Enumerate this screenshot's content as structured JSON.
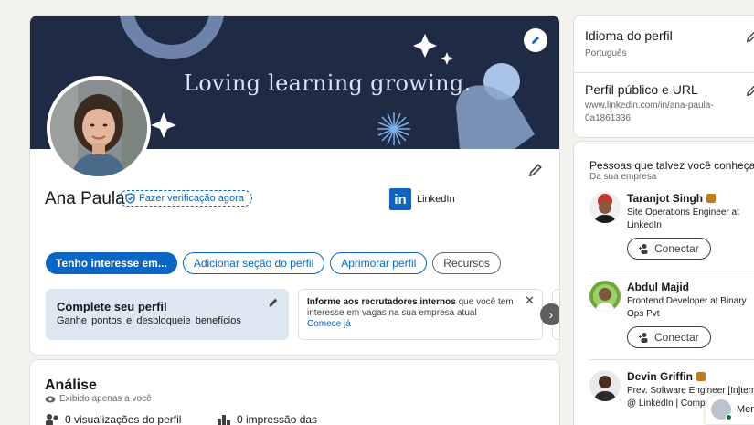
{
  "profile": {
    "banner_text": "Loving learning growing.",
    "name": "Ana Paula",
    "verify_label": "Fazer verificação agora",
    "company": "LinkedIn",
    "company_logo_text": "in",
    "buttons": {
      "interest": "Tenho interesse em...",
      "add_section": "Adicionar seção do perfil",
      "improve": "Aprimorar perfil",
      "resources": "Recursos"
    },
    "complete": {
      "title": "Complete seu perfil",
      "subtitle": "Ganhe pontos e desbloqueie benefícios"
    },
    "recruiter": {
      "bold": "Informe aos recrutadores internos",
      "text": " que você tem interesse em vagas na sua empresa atual",
      "link": "Comece já"
    }
  },
  "analysis": {
    "title": "Análise",
    "visibility": "Exibido apenas a você",
    "views": "0 visualizações do perfil",
    "impressions": "0 impressão das"
  },
  "sidebar": {
    "language_title": "Idioma do perfil",
    "language_value": "Português",
    "public_title": "Perfil público e URL",
    "public_url": "www.linkedin.com/in/ana-paula-0a1861336"
  },
  "people": {
    "title": "Pessoas que talvez você conheça",
    "subtitle": "Da sua empresa",
    "connect_label": "Conectar",
    "items": [
      {
        "name": "Taranjot Singh",
        "headline": "Site Operations Engineer at LinkedIn"
      },
      {
        "name": "Abdul Majid",
        "headline": "Frontend Developer at Binary Ops Pvt"
      },
      {
        "name": "Devin Griffin",
        "headline": "Prev. Software Engineer [In]tern @ LinkedIn | Comp"
      }
    ]
  },
  "messaging": {
    "label": "Men"
  },
  "colors": {
    "brand": "#0a66c2",
    "banner_bg": "#1f2a44",
    "page_bg": "#f4f2ee",
    "premium": "#c37d16"
  }
}
